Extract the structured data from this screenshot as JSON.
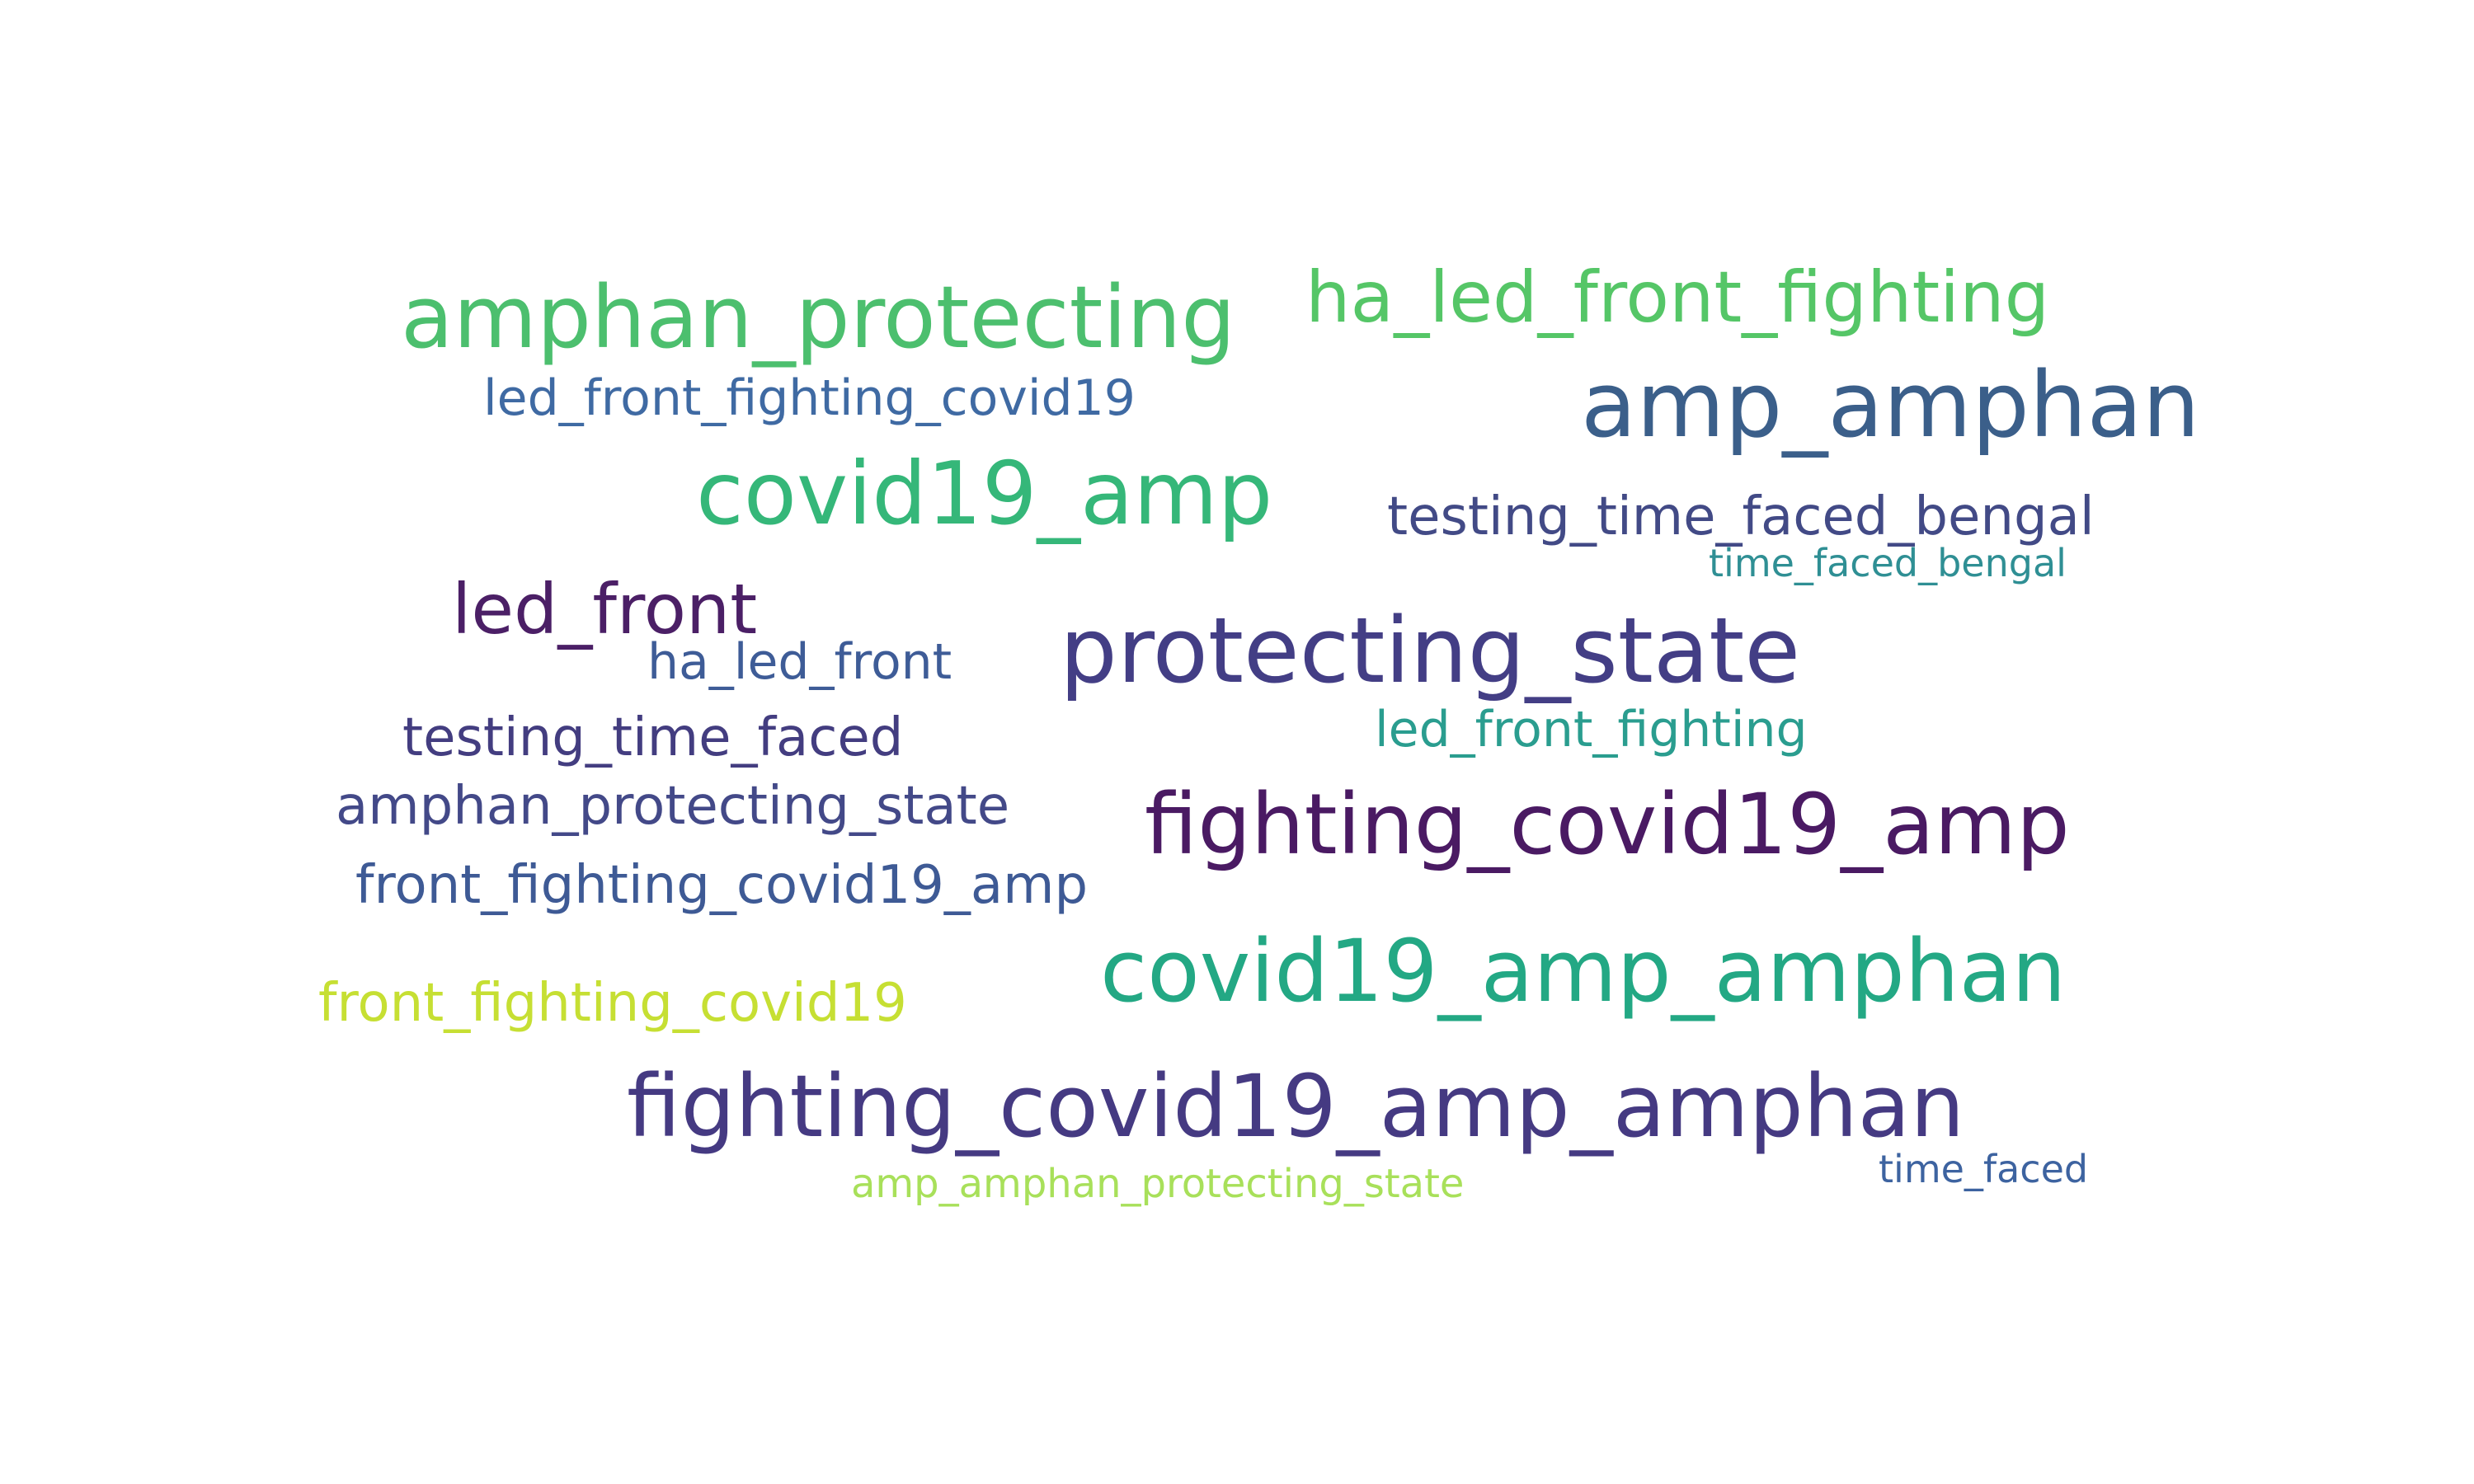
{
  "words": [
    {
      "text": "amphan_protecting",
      "color": "#4cbf6e"
    },
    {
      "text": "ha_led_front_fighting",
      "color": "#55c667"
    },
    {
      "text": "led_front_fighting_covid19",
      "color": "#3f6aa3"
    },
    {
      "text": "amp_amphan",
      "color": "#3b5f8a"
    },
    {
      "text": "covid19_amp",
      "color": "#35b779"
    },
    {
      "text": "testing_time_faced_bengal",
      "color": "#424a86"
    },
    {
      "text": "time_faced_bengal",
      "color": "#2f8f94"
    },
    {
      "text": "led_front",
      "color": "#4b1f66"
    },
    {
      "text": "protecting_state",
      "color": "#433e85"
    },
    {
      "text": "ha_led_front",
      "color": "#3e5c97"
    },
    {
      "text": "testing_time_faced",
      "color": "#433d80"
    },
    {
      "text": "led_front_fighting",
      "color": "#2a9d8f"
    },
    {
      "text": "amphan_protecting_state",
      "color": "#434988"
    },
    {
      "text": "fighting_covid19_amp",
      "color": "#4a1a63"
    },
    {
      "text": "front_fighting_covid19_amp",
      "color": "#3e5a95"
    },
    {
      "text": "front_fighting_covid19",
      "color": "#c6df33"
    },
    {
      "text": "covid19_amp_amphan",
      "color": "#23a884"
    },
    {
      "text": "fighting_covid19_amp_amphan",
      "color": "#453a82"
    },
    {
      "text": "amp_amphan_protecting_state",
      "color": "#a8e05a"
    },
    {
      "text": "time_faced",
      "color": "#3d63a0"
    }
  ]
}
